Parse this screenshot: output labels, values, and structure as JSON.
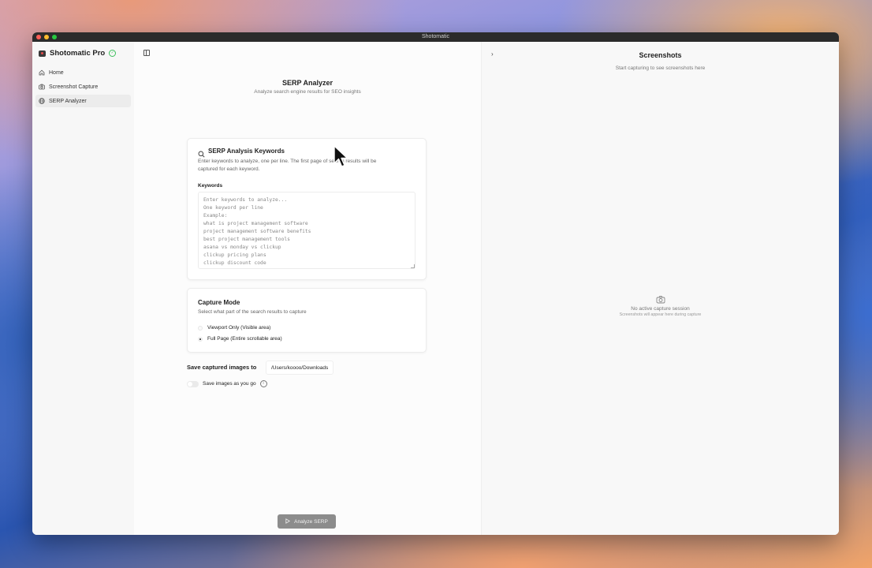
{
  "window": {
    "title": "Shotomatic"
  },
  "sidebar": {
    "brand": "Shotomatic Pro",
    "items": [
      {
        "label": "Home",
        "icon": "home-icon",
        "active": false
      },
      {
        "label": "Screenshot Capture",
        "icon": "camera-icon",
        "active": false
      },
      {
        "label": "SERP Analyzer",
        "icon": "globe-icon",
        "active": true
      }
    ]
  },
  "main": {
    "title": "SERP Analyzer",
    "subtitle": "Analyze search engine results for SEO insights",
    "keywords_card": {
      "title": "SERP Analysis Keywords",
      "description_line1": "Enter keywords to analyze, one per line. The first page of search results will be",
      "description_line2": "captured for each keyword.",
      "field_label": "Keywords",
      "placeholder": "Enter keywords to analyze...\nOne keyword per line\nExample:\nwhat is project management software\nproject management software benefits\nbest project management tools\nasana vs monday vs clickup\nclickup pricing plans\nclickup discount code"
    },
    "capture_mode_card": {
      "title": "Capture Mode",
      "description": "Select what part of the search results to capture",
      "options": [
        {
          "label": "Viewport Only (Visible area)",
          "selected": false
        },
        {
          "label": "Full Page (Entire scrollable area)",
          "selected": true
        }
      ]
    },
    "save": {
      "label": "Save captured images to",
      "path": "/Users/koooo/Downloads",
      "toggle_label": "Save images as you go",
      "toggle_on": false
    },
    "analyze_button": "Analyze SERP"
  },
  "screenshots_panel": {
    "title": "Screenshots",
    "subtitle": "Start capturing to see screenshots here",
    "empty_title": "No active capture session",
    "empty_sub": "Screenshots will appear here during capture"
  }
}
